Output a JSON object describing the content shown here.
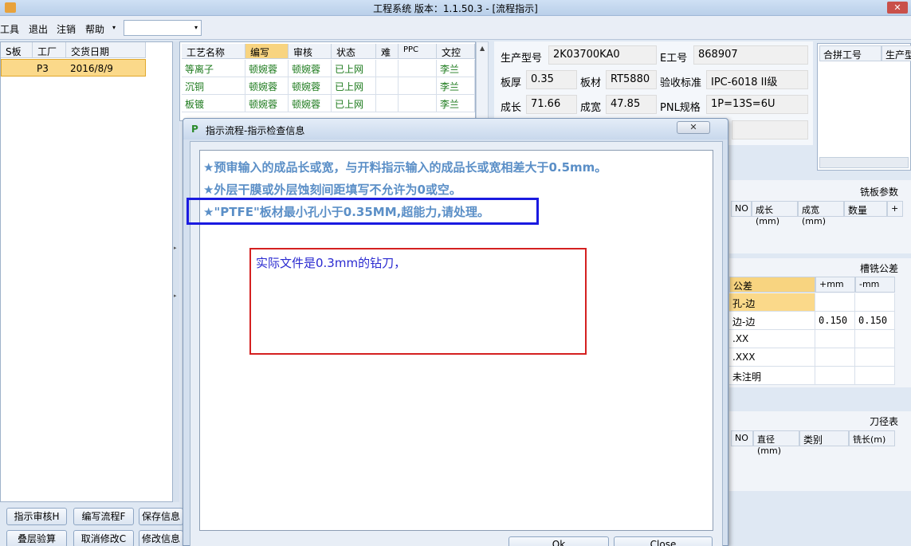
{
  "window": {
    "title": "工程系统   版本：1.1.50.3 - [流程指示]",
    "close_glyph": "✕"
  },
  "menu": {
    "items": [
      "工具",
      "退出",
      "注销",
      "帮助"
    ],
    "dropdown_glyph": "▾",
    "combo_value": ""
  },
  "left_table": {
    "headers": [
      "S板",
      "工厂",
      "交货日期"
    ],
    "rows": [
      {
        "factory": "P3",
        "date": "2016/8/9"
      }
    ]
  },
  "bottom_buttons": {
    "row1": [
      "指示审核H",
      "编写流程F",
      "保存信息"
    ],
    "row2": [
      "叠层验算",
      "取消修改C",
      "修改信息"
    ]
  },
  "process_table": {
    "headers": [
      "工艺名称",
      "编写",
      "审核",
      "状态",
      "难",
      "PPC",
      "文控"
    ],
    "rows": [
      [
        "等离子",
        "顿婉蓉",
        "顿婉蓉",
        "已上网",
        "",
        "",
        "李兰"
      ],
      [
        "沉铜",
        "顿婉蓉",
        "顿婉蓉",
        "已上网",
        "",
        "",
        "李兰"
      ],
      [
        "板镀",
        "顿婉蓉",
        "顿婉蓉",
        "已上网",
        "",
        "",
        "李兰"
      ]
    ]
  },
  "info": {
    "model_label": "生产型号",
    "model_value": "2K03700KA0",
    "e_label": "E工号",
    "e_value": "868907",
    "thickness_label": "板厚",
    "thickness_value": "0.35",
    "material_label": "板材",
    "material_value": "RT5880",
    "standard_label": "验收标准",
    "standard_value": "IPC-6018 II级",
    "length_label": "成长",
    "length_value": "71.66",
    "width_label": "成宽",
    "width_value": "47.85",
    "pnl_label": "PNL规格",
    "pnl_value": "1P=13S=6U"
  },
  "merge_table": {
    "headers": [
      "合拼工号",
      "生产型"
    ]
  },
  "milling": {
    "title": "铣板参数",
    "headers": [
      "NO",
      "成长(mm)",
      "成宽(mm)",
      "数量",
      "+"
    ]
  },
  "tolerance": {
    "title": "槽铣公差",
    "headers": [
      "公差",
      "+mm",
      "-mm"
    ],
    "rows": [
      [
        "孔-边",
        "",
        ""
      ],
      [
        "边-边",
        "0.150",
        "0.150"
      ],
      [
        ".XX",
        "",
        ""
      ],
      [
        ".XXX",
        "",
        ""
      ],
      [
        "未注明",
        "",
        ""
      ]
    ]
  },
  "tools": {
    "title": "刀径表",
    "headers": [
      "NO",
      "直径(mm)",
      "类别",
      "铣长(m)"
    ]
  },
  "dialog": {
    "title": "指示流程-指示检查信息",
    "icon_glyph": "P",
    "close_glyph": "✕",
    "messages": [
      "★预审输入的成品长或宽，与开料指示输入的成品长或宽相差大于0.5mm。",
      "★外层干膜或外层蚀刻间距填写不允许为0或空。",
      "★\"PTFE\"板材最小孔小于0.35MM,超能力,请处理。"
    ],
    "annotation": "实际文件是0.3mm的钻刀，",
    "ok_label": "Ok",
    "close_label": "Close"
  }
}
